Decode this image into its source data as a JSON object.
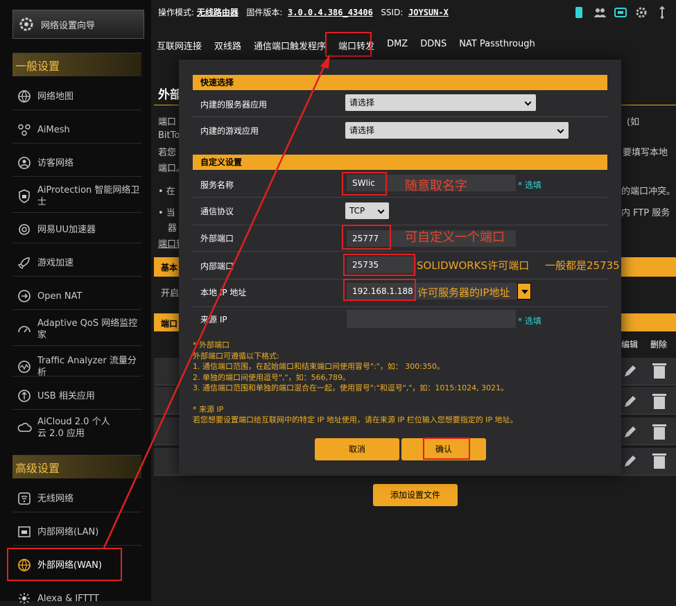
{
  "sidebar": {
    "wizard_label": "网络设置向导",
    "general_header": "一般设置",
    "advanced_header": "高级设置",
    "general_items": [
      {
        "label": "网络地图",
        "icon": "globe-icon"
      },
      {
        "label": "AiMesh",
        "icon": "mesh-icon"
      },
      {
        "label": "访客网络",
        "icon": "guest-icon"
      },
      {
        "label": "AiProtection 智能网络卫士",
        "icon": "shield-icon"
      },
      {
        "label": "网易UU加速器",
        "icon": "uu-icon"
      },
      {
        "label": "游戏加速",
        "icon": "rocket-icon"
      },
      {
        "label": "Open NAT",
        "icon": "nat-icon"
      },
      {
        "label": "Adaptive QoS 网络监控家",
        "icon": "gauge-icon"
      },
      {
        "label": "Traffic Analyzer 流量分析",
        "icon": "traffic-icon"
      },
      {
        "label": "USB 相关应用",
        "icon": "usb-icon"
      },
      {
        "label": "AiCloud 2.0 个人云 2.0 应用",
        "icon": "cloud-icon"
      }
    ],
    "advanced_items": [
      {
        "label": "无线网络",
        "icon": "wifi-icon"
      },
      {
        "label": "内部网络(LAN)",
        "icon": "lan-icon"
      },
      {
        "label": "外部网络(WAN)",
        "icon": "wan-globe-icon"
      },
      {
        "label": "Alexa & IFTTT",
        "icon": "alexa-icon"
      }
    ]
  },
  "topbar": {
    "mode_label": "操作模式:",
    "mode_value": "无线路由器",
    "fw_label": "固件版本:",
    "fw_value": "3.0.0.4.386_43406",
    "ssid_label": "SSID:",
    "ssid_value": "JOYSUN-X"
  },
  "tabs": [
    "互联网连接",
    "双线路",
    "通信端口触发程序",
    "端口转发",
    "DMZ",
    "DDNS",
    "NAT Passthrough"
  ],
  "background": {
    "title": "外部",
    "line1": "端口",
    "line1_right": "(如",
    "line2": "BitTor",
    "line3": "若您",
    "line3_right": "要填写本地",
    "line4": "端口。",
    "bullet1": "• 在",
    "bullet1_right": "的端口冲突。",
    "bullet2": "• 当",
    "bullet2_right": "内 FTP 服务",
    "line5": "器",
    "line6": "端口转",
    "bar1": "基本",
    "open_label": "开启",
    "bar2": "端口",
    "edit_col": "编辑",
    "delete_col": "删除",
    "add_profile": "添加设置文件"
  },
  "modal": {
    "quick_header": "快速选择",
    "server_app_label": "内建的服务器应用",
    "server_app_value": "请选择",
    "game_app_label": "内建的游戏应用",
    "game_app_value": "请选择",
    "custom_header": "自定义设置",
    "service_name_label": "服务名称",
    "service_name_value": "SWlic",
    "protocol_label": "通信协议",
    "protocol_value": "TCP",
    "ext_port_label": "外部端口",
    "ext_port_value": "25777",
    "int_port_label": "内部端口",
    "int_port_value": "25735",
    "local_ip_label": "本地 IP 地址",
    "local_ip_value": "192.168.1.188",
    "source_ip_label": "来源 IP",
    "source_ip_value": "",
    "optional_link": "* 选填",
    "notes": [
      "* 外部端口",
      "外部端口可遵循以下格式:",
      "1. 通信端口范围，在起始端口和结束端口间使用冒号\":\"，如： 300:350。",
      "2. 单独的端口间使用逗号\",\"，如：566,789。",
      "3. 通信端口范围和单独的端口混合在一起，使用冒号\":\"和逗号\",\"，如：1015:1024, 3021。",
      "",
      "* 来源 IP",
      "若您想要设置端口给互联网中的特定 IP 地址使用，请在来源 IP 栏位输入您想要指定的 IP 地址。"
    ],
    "cancel_label": "取消",
    "confirm_label": "确认"
  },
  "annotations": {
    "name_hint": "随意取名字",
    "port_hint": "可自定义一个端口",
    "int_port_hint_a": "SOLIDWORKS许可端口",
    "int_port_hint_b": "一般都是25735",
    "ip_hint": "许可服务器的IP地址"
  },
  "colors": {
    "accent": "#f0a623",
    "annotation_red": "#e02020",
    "link": "#2fd6d6"
  }
}
